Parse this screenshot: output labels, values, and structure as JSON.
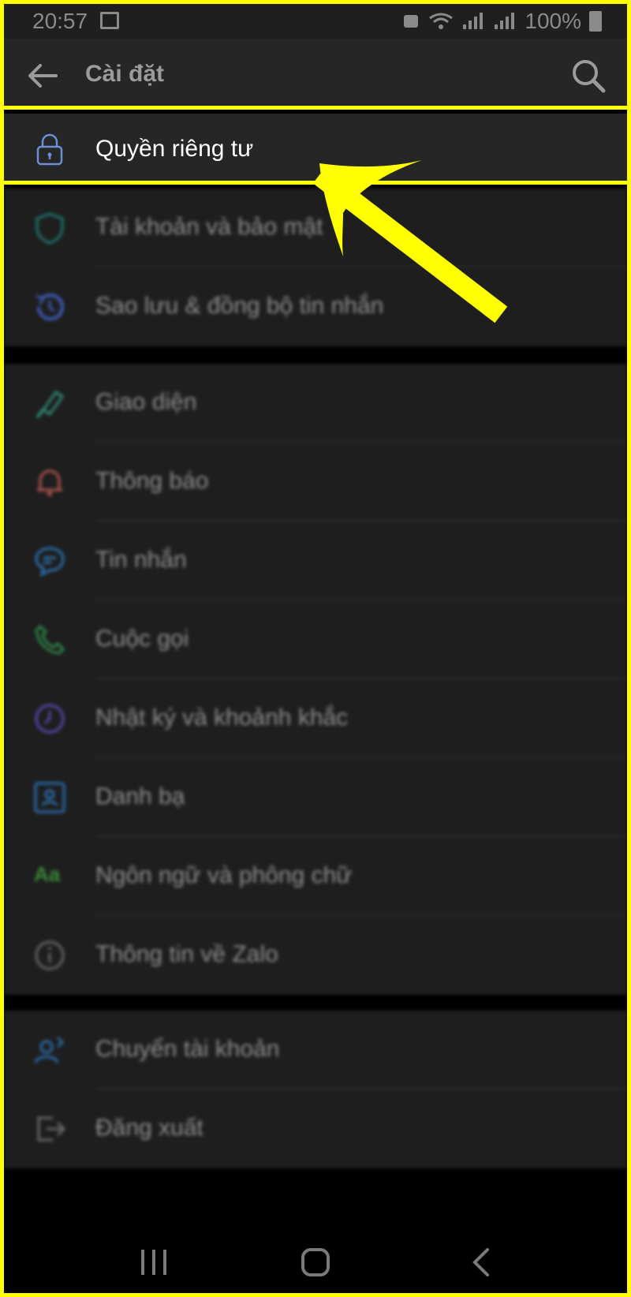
{
  "status_bar": {
    "time": "20:57",
    "battery": "100%"
  },
  "header": {
    "title": "Cài đặt"
  },
  "privacy": {
    "label": "Quyền riêng tư",
    "icon": "lock-icon"
  },
  "sections": {
    "s1": [
      {
        "label": "Tài khoản và bảo mật",
        "icon": "shield-icon",
        "color": "#1f7a70"
      },
      {
        "label": "Sao lưu & đồng bộ tin nhắn",
        "icon": "history-icon",
        "color": "#3c5bb5"
      }
    ],
    "s2": [
      {
        "label": "Giao diện",
        "icon": "paint-brush-icon",
        "color": "#2e8a77"
      },
      {
        "label": "Thông báo",
        "icon": "bell-icon",
        "color": "#b2564f"
      },
      {
        "label": "Tin nhắn",
        "icon": "chat-bubble-icon",
        "color": "#2b76b5"
      },
      {
        "label": "Cuộc gọi",
        "icon": "phone-icon",
        "color": "#2e8a4a"
      },
      {
        "label": "Nhật ký và khoảnh khắc",
        "icon": "clock-icon",
        "color": "#5a4bb3"
      },
      {
        "label": "Danh bạ",
        "icon": "contacts-icon",
        "color": "#2b6fb0"
      },
      {
        "label": "Ngôn ngữ và phông chữ",
        "icon": "font-icon",
        "color": "#3b8a3a"
      },
      {
        "label": "Thông tin về Zalo",
        "icon": "info-icon",
        "color": "#6a6a6a"
      }
    ],
    "s3": [
      {
        "label": "Chuyển tài khoản",
        "icon": "switch-account-icon",
        "color": "#2b6fb0"
      },
      {
        "label": "Đăng xuất",
        "icon": "logout-icon",
        "color": "#6a6a6a"
      }
    ]
  },
  "font_icon_text": "Aa",
  "colors": {
    "highlight": "#ffff00",
    "lock_icon": "#6b8fd6"
  }
}
